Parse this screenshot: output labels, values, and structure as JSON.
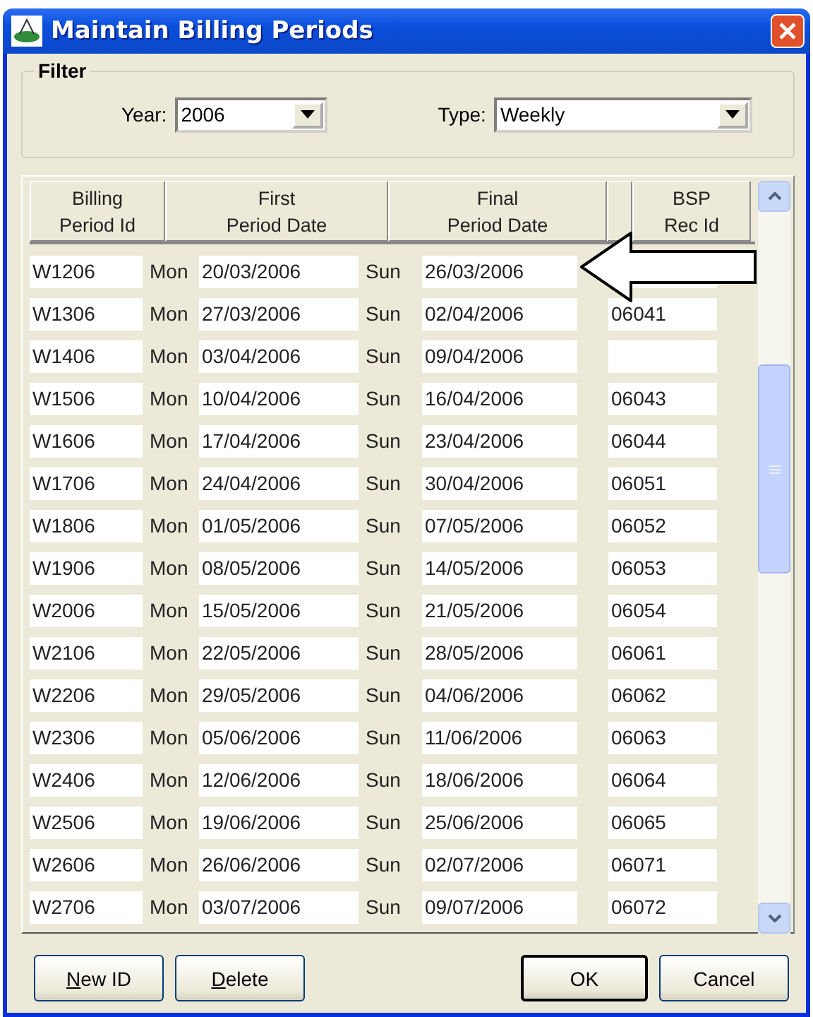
{
  "window": {
    "title": "Maintain Billing Periods"
  },
  "filter": {
    "legend": "Filter",
    "year_label": "Year:",
    "year": "2006",
    "type_label": "Type:",
    "type": "Weekly"
  },
  "table": {
    "columns": [
      "Billing\nPeriod Id",
      "First\nPeriod Date",
      "Final\nPeriod Date",
      "BSP\nRec Id"
    ],
    "rows": [
      {
        "id": "W1206",
        "first_day": "Mon",
        "first_date": "20/03/2006",
        "final_day": "Sun",
        "final_date": "26/03/2006"
      },
      {
        "id": "W1306",
        "first_day": "Mon",
        "first_date": "27/03/2006",
        "final_day": "Sun",
        "final_date": "02/04/2006",
        "bsp": "06041"
      },
      {
        "id": "W1406",
        "first_day": "Mon",
        "first_date": "03/04/2006",
        "final_day": "Sun",
        "final_date": "09/04/2006"
      },
      {
        "id": "W1506",
        "first_day": "Mon",
        "first_date": "10/04/2006",
        "final_day": "Sun",
        "final_date": "16/04/2006",
        "bsp": "06043"
      },
      {
        "id": "W1606",
        "first_day": "Mon",
        "first_date": "17/04/2006",
        "final_day": "Sun",
        "final_date": "23/04/2006",
        "bsp": "06044"
      },
      {
        "id": "W1706",
        "first_day": "Mon",
        "first_date": "24/04/2006",
        "final_day": "Sun",
        "final_date": "30/04/2006",
        "bsp": "06051"
      },
      {
        "id": "W1806",
        "first_day": "Mon",
        "first_date": "01/05/2006",
        "final_day": "Sun",
        "final_date": "07/05/2006",
        "bsp": "06052"
      },
      {
        "id": "W1906",
        "first_day": "Mon",
        "first_date": "08/05/2006",
        "final_day": "Sun",
        "final_date": "14/05/2006",
        "bsp": "06053"
      },
      {
        "id": "W2006",
        "first_day": "Mon",
        "first_date": "15/05/2006",
        "final_day": "Sun",
        "final_date": "21/05/2006",
        "bsp": "06054"
      },
      {
        "id": "W2106",
        "first_day": "Mon",
        "first_date": "22/05/2006",
        "final_day": "Sun",
        "final_date": "28/05/2006",
        "bsp": "06061"
      },
      {
        "id": "W2206",
        "first_day": "Mon",
        "first_date": "29/05/2006",
        "final_day": "Sun",
        "final_date": "04/06/2006",
        "bsp": "06062"
      },
      {
        "id": "W2306",
        "first_day": "Mon",
        "first_date": "05/06/2006",
        "final_day": "Sun",
        "final_date": "11/06/2006",
        "bsp": "06063"
      },
      {
        "id": "W2406",
        "first_day": "Mon",
        "first_date": "12/06/2006",
        "final_day": "Sun",
        "final_date": "18/06/2006",
        "bsp": "06064"
      },
      {
        "id": "W2506",
        "first_day": "Mon",
        "first_date": "19/06/2006",
        "final_day": "Sun",
        "final_date": "25/06/2006",
        "bsp": "06065"
      },
      {
        "id": "W2606",
        "first_day": "Mon",
        "first_date": "26/06/2006",
        "final_day": "Sun",
        "final_date": "02/07/2006",
        "bsp": "06071"
      },
      {
        "id": "W2706",
        "first_day": "Mon",
        "first_date": "03/07/2006",
        "final_day": "Sun",
        "final_date": "09/07/2006",
        "bsp": "06072"
      }
    ]
  },
  "buttons": [
    {
      "label": "New ID",
      "mnemonic_underline": true,
      "default": false
    },
    {
      "label": "Delete",
      "mnemonic_underline": true,
      "default": false
    },
    {
      "label": "OK",
      "default": true
    },
    {
      "label": "Cancel",
      "default": false
    }
  ]
}
